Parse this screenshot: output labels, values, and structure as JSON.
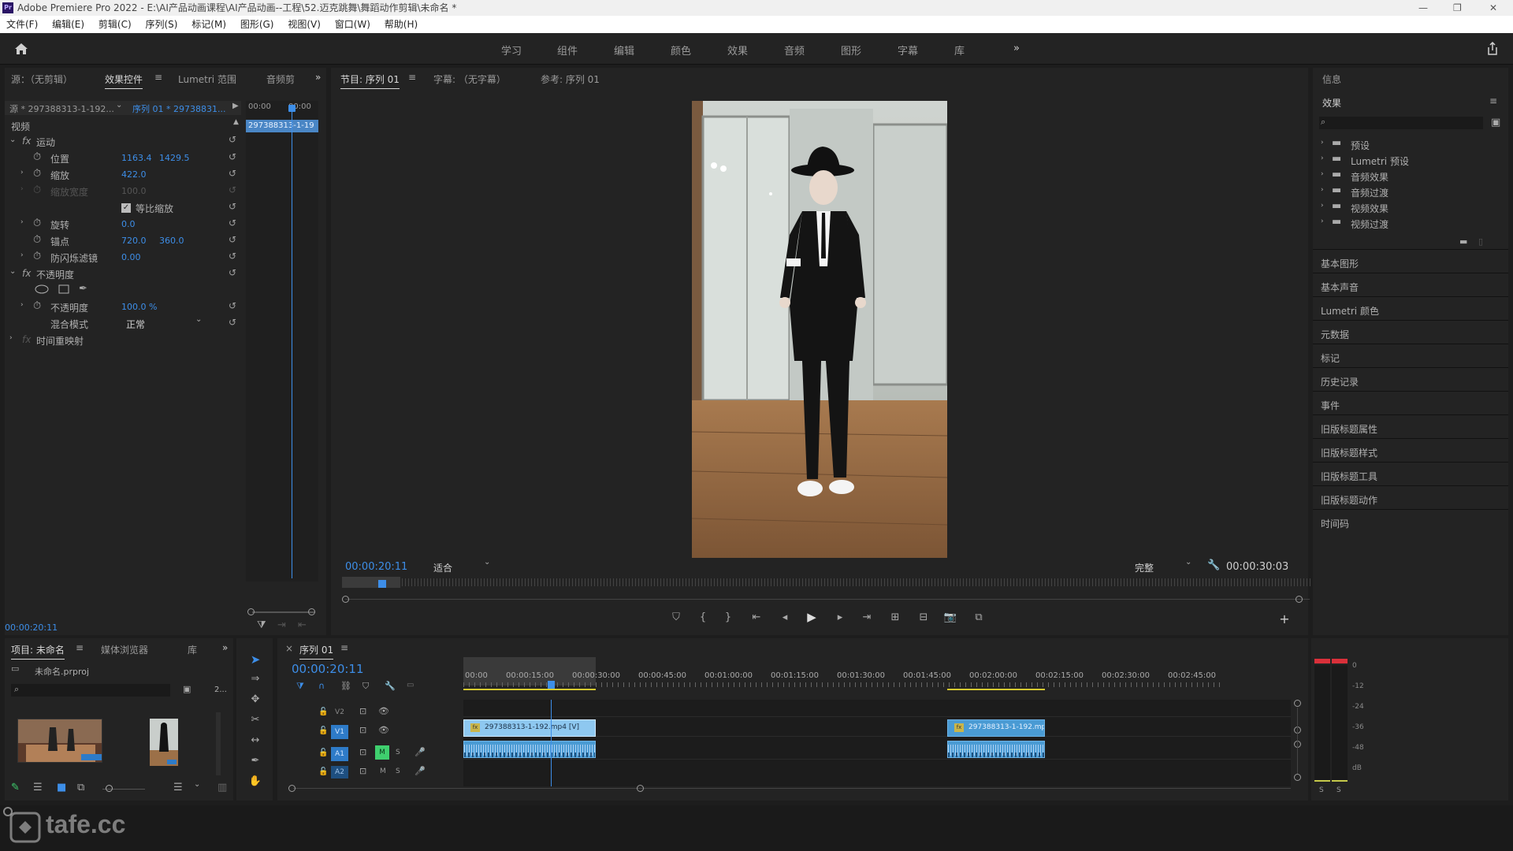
{
  "titlebar": {
    "app_icon": "Pr",
    "title": "Adobe Premiere Pro 2022 - E:\\AI产品动画课程\\AI产品动画--工程\\52.迈克跳舞\\舞蹈动作剪辑\\未命名 *",
    "minimize": "—",
    "restore": "❐",
    "close": "✕"
  },
  "menubar": {
    "items": [
      "文件(F)",
      "编辑(E)",
      "剪辑(C)",
      "序列(S)",
      "标记(M)",
      "图形(G)",
      "视图(V)",
      "窗口(W)",
      "帮助(H)"
    ]
  },
  "workspaces": {
    "items": [
      "学习",
      "组件",
      "编辑",
      "颜色",
      "效果",
      "音频",
      "图形",
      "字幕",
      "库"
    ],
    "more": "»",
    "home_icon": "home-icon",
    "share_icon": "share-icon"
  },
  "source_panel": {
    "tabs": [
      "源：（无剪辑）",
      "效果控件",
      "Lumetri 范围",
      "音频剪"
    ],
    "tabs_more": "»",
    "source_clip": "源 * 297388313-1-192...",
    "sequence_clip": "序列 01 * 29738831...",
    "mini_timecode_start": "00:00",
    "mini_timecode_end": "00:00",
    "mini_clip_label": "297388313-1-19",
    "video_header": "视频",
    "motion_label": "运动",
    "fx": "fx",
    "position_label": "位置",
    "position_x": "1163.4",
    "position_y": "1429.5",
    "scale_label": "缩放",
    "scale_value": "422.0",
    "scale_width_label": "缩放宽度",
    "scale_width_value": "100.0",
    "uniform_scale_label": "等比缩放",
    "rotation_label": "旋转",
    "rotation_value": "0.0",
    "anchor_label": "锚点",
    "anchor_x": "720.0",
    "anchor_y": "360.0",
    "antiflicker_label": "防闪烁滤镜",
    "antiflicker_value": "0.00",
    "opacity_group_label": "不透明度",
    "opacity_label": "不透明度",
    "opacity_value": "100.0 %",
    "blend_label": "混合模式",
    "blend_value": "正常",
    "time_remap_label": "时间重映射",
    "footer_timecode": "00:00:20:11"
  },
  "program_panel": {
    "tabs": [
      "节目: 序列 01",
      "字幕: （无字幕）",
      "参考: 序列 01"
    ],
    "current_timecode": "00:00:20:11",
    "fit_label": "适合",
    "quality_label": "完整",
    "duration": "00:00:30:03"
  },
  "effects_panel": {
    "info_tab": "信息",
    "effects_tab": "效果",
    "tree": [
      "预设",
      "Lumetri 预设",
      "音频效果",
      "音频过渡",
      "视频效果",
      "视频过渡"
    ],
    "side_panels": [
      "基本图形",
      "基本声音",
      "Lumetri 颜色",
      "元数据",
      "标记",
      "历史记录",
      "事件",
      "旧版标题属性",
      "旧版标题样式",
      "旧版标题工具",
      "旧版标题动作",
      "时间码"
    ]
  },
  "project_panel": {
    "tabs": [
      "项目: 未命名",
      "媒体浏览器",
      "库"
    ],
    "tabs_more": "»",
    "project_file": "未命名.prproj",
    "item_count": "2..."
  },
  "timeline": {
    "tab": "序列 01",
    "timecode": "00:00:20:11",
    "ruler": [
      "00:00",
      "00:00:15:00",
      "00:00:30:00",
      "00:00:45:00",
      "00:01:00:00",
      "00:01:15:00",
      "00:01:30:00",
      "00:01:45:00",
      "00:02:00:00",
      "00:02:15:00",
      "00:02:30:00",
      "00:02:45:00"
    ],
    "tracks": [
      {
        "name": "V2",
        "type": "video"
      },
      {
        "name": "V1",
        "type": "video"
      },
      {
        "name": "A1",
        "type": "audio",
        "m": "M",
        "s": "S"
      },
      {
        "name": "A2",
        "type": "audio",
        "m": "M",
        "s": "S"
      }
    ],
    "clip_v1_a": "297388313-1-192.mp4 [V]",
    "clip_v1_b": "297388313-1-192.mp4"
  },
  "audio_meter": {
    "scale": [
      "0",
      "-12",
      "-24",
      "-36",
      "-48",
      "dB"
    ],
    "solo_left": "S",
    "solo_right": "S"
  },
  "watermark": {
    "text": "tafe.cc"
  },
  "colors": {
    "accent": "#3d8ee8",
    "panel_bg": "#232323",
    "clip_video": "#8ec8f0",
    "clip_audio": "#4a9bd4",
    "track_active": "#2e7bc8",
    "mute_green": "#3fcf6e"
  }
}
